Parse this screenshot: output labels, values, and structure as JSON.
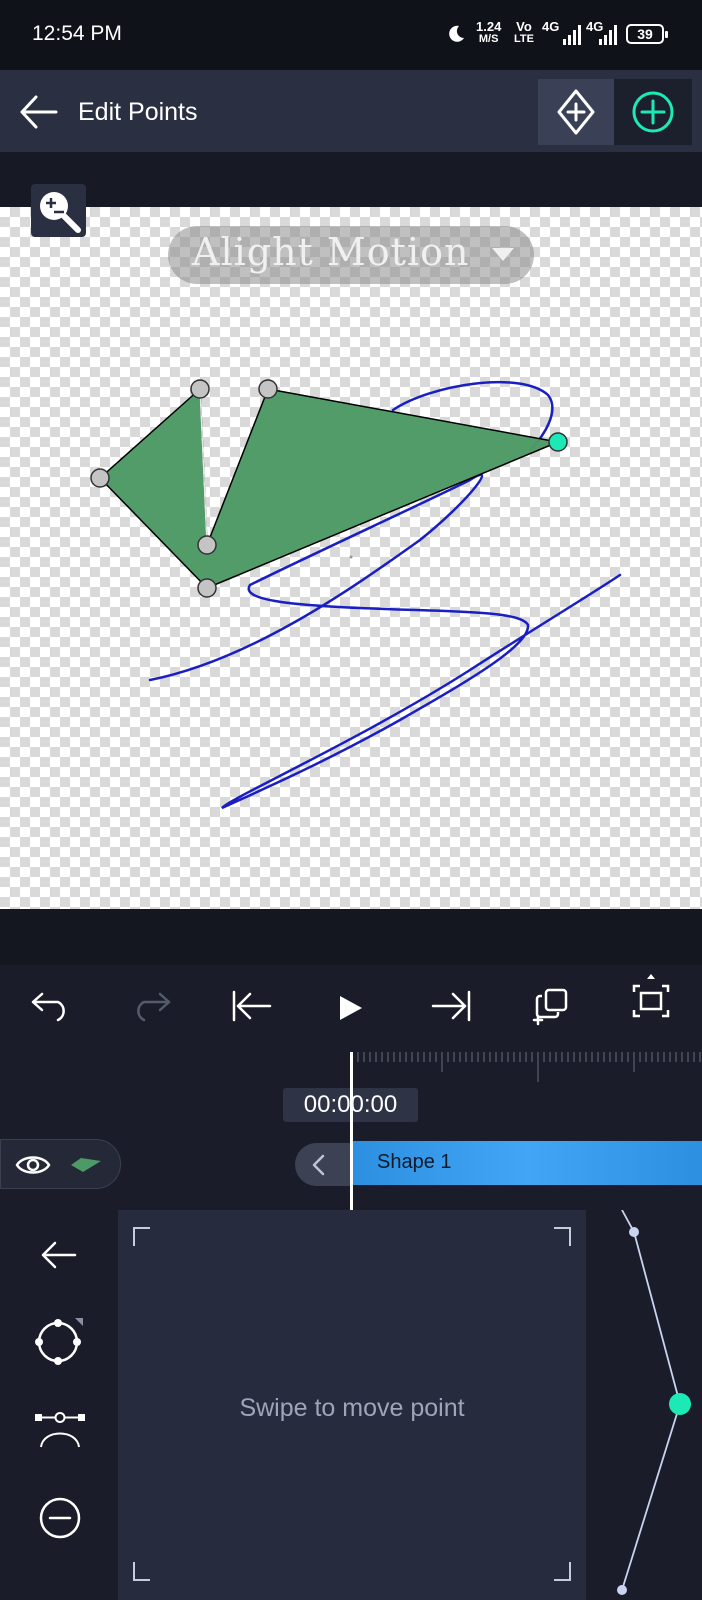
{
  "status_bar": {
    "time": "12:54 PM",
    "net_speed_top": "1.24",
    "net_speed_bottom": "M/S",
    "volte_top": "Vo",
    "volte_bottom": "LTE",
    "signal1_label": "4G",
    "signal2_label": "4G",
    "battery": "39"
  },
  "app_bar": {
    "title": "Edit Points"
  },
  "canvas": {
    "watermark": "Alight Motion"
  },
  "timeline": {
    "time": "00:00:00",
    "clip_label": "Shape 1"
  },
  "touch_pad": {
    "hint": "Swipe to move point"
  },
  "colors": {
    "accent": "#1de9b6",
    "shape_fill": "#4e9a66",
    "stroke": "#1a1fc4",
    "clip": "#42a5f5"
  }
}
